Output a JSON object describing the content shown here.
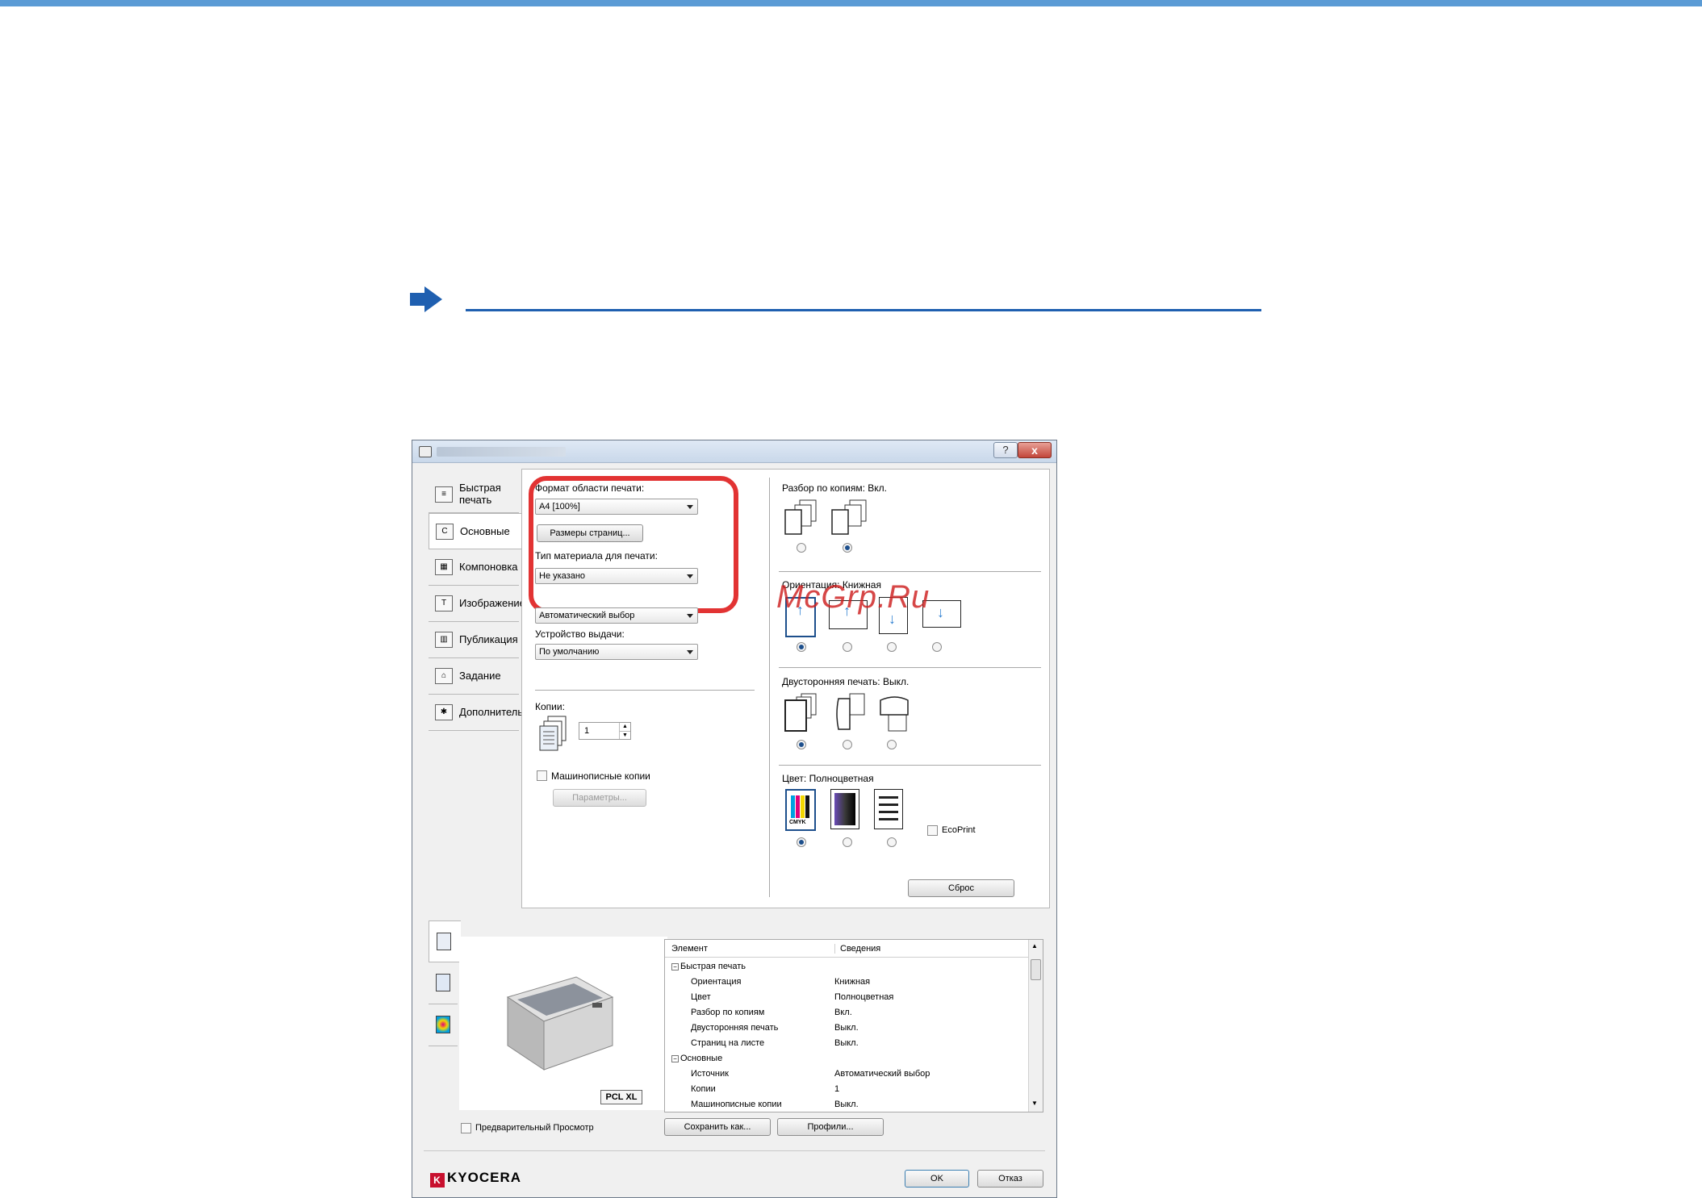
{
  "dialog": {
    "tabs": [
      {
        "label": "Быстрая печать",
        "icon": "quick-print-icon"
      },
      {
        "label": "Основные",
        "icon": "basic-icon"
      },
      {
        "label": "Компоновка",
        "icon": "layout-icon"
      },
      {
        "label": "Изображение",
        "icon": "image-icon"
      },
      {
        "label": "Публикация",
        "icon": "publishing-icon"
      },
      {
        "label": "Задание",
        "icon": "job-icon"
      },
      {
        "label": "Дополнительно",
        "icon": "advanced-icon"
      }
    ],
    "left": {
      "print_area_label": "Формат области печати:",
      "print_area_value": "A4  [100%]",
      "page_sizes_button": "Размеры страниц...",
      "media_type_label": "Тип материала для печати:",
      "media_type_value": "Не указано",
      "source_value": "Автоматический выбор",
      "output_label": "Устройство выдачи:",
      "output_value": "По умолчанию",
      "copies_label": "Копии:",
      "copies_value": "1",
      "typewriter_copies_label": "Машинописные копии",
      "params_button": "Параметры..."
    },
    "right": {
      "collate_label": "Разбор по копиям:",
      "collate_value": "Вкл.",
      "orientation_label": "Ориентация:",
      "orientation_value": "Книжная",
      "duplex_label": "Двусторонняя печать:",
      "duplex_value": "Выкл.",
      "color_label": "Цвет:",
      "color_value": "Полноцветная",
      "cmyk_text": "CMYK",
      "ecoprint_label": "EcoPrint",
      "reset_button": "Сброс"
    },
    "preview": {
      "badge": "PCL XL",
      "preview_checkbox_label": "Предварительный Просмотр"
    },
    "summary": {
      "headers": [
        "Элемент",
        "Сведения"
      ],
      "rows": [
        {
          "item": "Быстрая печать",
          "value": "",
          "group": true
        },
        {
          "item": "Ориентация",
          "value": "Книжная",
          "group": false
        },
        {
          "item": "Цвет",
          "value": "Полноцветная",
          "group": false
        },
        {
          "item": "Разбор по копиям",
          "value": "Вкл.",
          "group": false
        },
        {
          "item": "Двусторонняя печать",
          "value": "Выкл.",
          "group": false
        },
        {
          "item": "Страниц на листе",
          "value": "Выкл.",
          "group": false
        },
        {
          "item": "Основные",
          "value": "",
          "group": true
        },
        {
          "item": "Источник",
          "value": "Автоматический выбор",
          "group": false
        },
        {
          "item": "Копии",
          "value": "1",
          "group": false
        },
        {
          "item": "Машинописные копии",
          "value": "Выкл.",
          "group": false
        }
      ]
    },
    "buttons": {
      "save_as": "Сохранить как...",
      "profiles": "Профили...",
      "ok": "OK",
      "cancel": "Отказ"
    },
    "brand": "KYOCERA",
    "help_glyph": "?",
    "close_glyph": "x"
  },
  "watermark": "McGrp.Ru",
  "colors": {
    "accent_bar": "#5b9bd5",
    "link": "#1f5fb0",
    "highlight": "#e23333"
  }
}
